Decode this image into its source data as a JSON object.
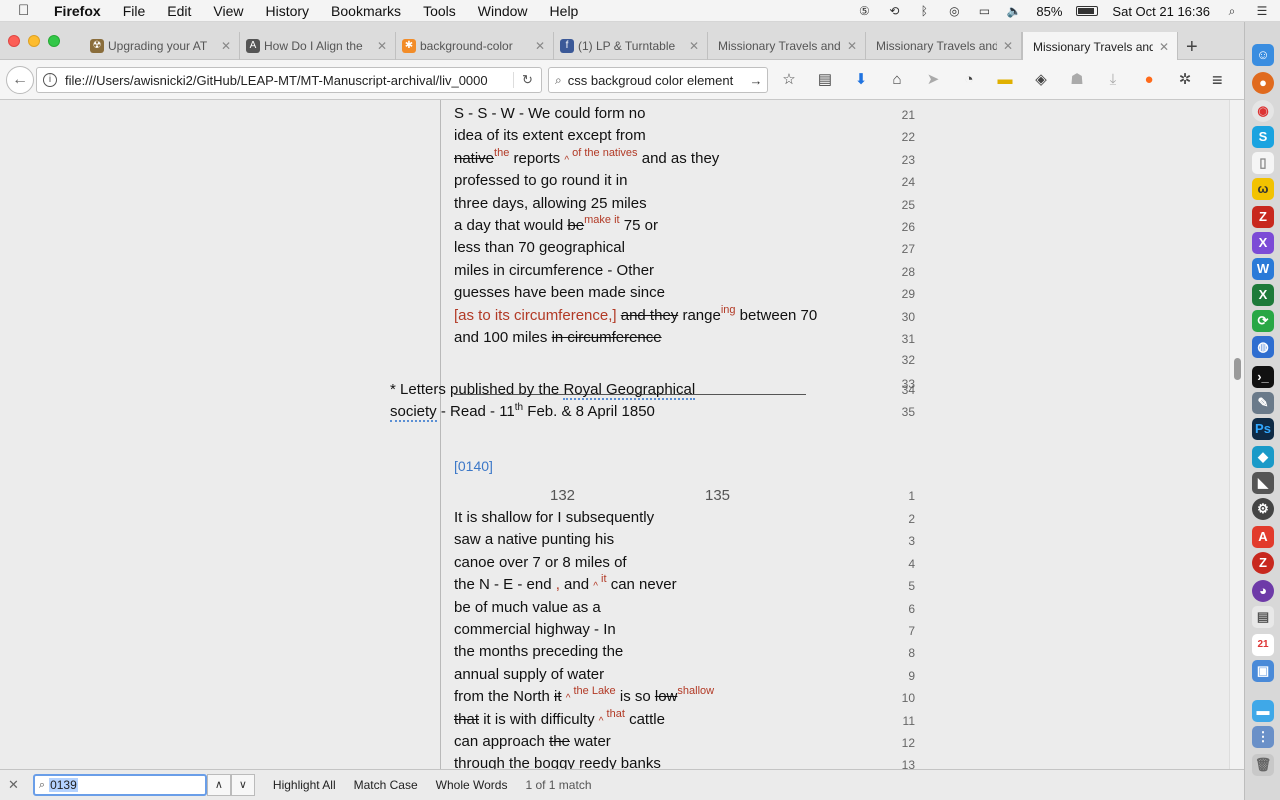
{
  "menubar": {
    "app": "Firefox",
    "items": [
      "File",
      "Edit",
      "View",
      "History",
      "Bookmarks",
      "Tools",
      "Window",
      "Help"
    ],
    "battery": "85%",
    "clock": "Sat Oct 21  16:36"
  },
  "tabs": [
    {
      "title": "Upgrading your AT",
      "icon": "atom-icon",
      "color": "#8a6d3b"
    },
    {
      "title": "How Do I Align the",
      "icon": "bird-icon",
      "color": "#555555"
    },
    {
      "title": "background-color",
      "icon": "star-icon",
      "color": "#f28c28"
    },
    {
      "title": "(1) LP & Turntable",
      "icon": "facebook-icon",
      "color": "#3b5998"
    },
    {
      "title": "Missionary Travels and",
      "icon": "page-icon",
      "color": "#999999"
    },
    {
      "title": "Missionary Travels and",
      "icon": "page-icon",
      "color": "#999999"
    },
    {
      "title": "Missionary Travels and",
      "icon": "page-icon",
      "color": "#999999"
    }
  ],
  "navbar": {
    "url": "file:///Users/awisnicki2/GitHub/LEAP-MT/MT-Manuscript-archival/liv_0000",
    "search": "css backgroud color element"
  },
  "manuscript": {
    "lines_top": [
      {
        "n": "21",
        "parts": [
          {
            "t": "S - S - W - We could form no",
            "c": ""
          }
        ]
      },
      {
        "n": "22",
        "parts": [
          {
            "t": "idea of its extent except from",
            "c": ""
          }
        ]
      },
      {
        "n": "23",
        "parts": [
          {
            "t": "native",
            "c": "del"
          },
          {
            "t": "the",
            "c": "sup"
          },
          {
            "t": " reports ",
            "c": ""
          },
          {
            "t": "^",
            "c": "caret"
          },
          {
            "t": " of the natives",
            "c": "sup"
          },
          {
            "t": " and as they",
            "c": ""
          }
        ]
      },
      {
        "n": "24",
        "parts": [
          {
            "t": "professed to go round it in",
            "c": ""
          }
        ]
      },
      {
        "n": "25",
        "parts": [
          {
            "t": "three days, allowing 25 miles",
            "c": ""
          }
        ]
      },
      {
        "n": "26",
        "parts": [
          {
            "t": "a day that would ",
            "c": ""
          },
          {
            "t": "be",
            "c": "del"
          },
          {
            "t": "make it",
            "c": "sup"
          },
          {
            "t": " 75 or",
            "c": ""
          }
        ]
      },
      {
        "n": "27",
        "parts": [
          {
            "t": "less than 70 geographical",
            "c": ""
          }
        ]
      },
      {
        "n": "28",
        "parts": [
          {
            "t": "miles in circumference - Other",
            "c": ""
          }
        ]
      },
      {
        "n": "29",
        "parts": [
          {
            "t": "guesses have been made since",
            "c": ""
          }
        ]
      },
      {
        "n": "30",
        "parts": [
          {
            "t": "[as to its circumference,]",
            "c": "red"
          },
          {
            "t": " ",
            "c": ""
          },
          {
            "t": "and they",
            "c": "del"
          },
          {
            "t": " range",
            "c": ""
          },
          {
            "t": "ing",
            "c": "sup"
          },
          {
            "t": " between 70",
            "c": ""
          }
        ]
      },
      {
        "n": "31",
        "parts": [
          {
            "t": "and 100 miles ",
            "c": ""
          },
          {
            "t": "in circumference",
            "c": "del"
          }
        ]
      }
    ],
    "line_numbers_footnote": [
      "32",
      "33",
      "34",
      "35"
    ],
    "footnote": {
      "line1_a": "* Letters published by the ",
      "line1_b": "Royal Geographical",
      "line2_a": "society",
      "line2_b": " - Read - 11",
      "line2_sup": "th",
      "line2_c": " Feb. & 8 April 1850"
    },
    "page_link": "[0140]",
    "page_numbers": {
      "left": "132",
      "right": "135",
      "n": "1"
    },
    "lines_bottom": [
      {
        "n": "2",
        "parts": [
          {
            "t": "It is shallow for I subsequently",
            "c": ""
          }
        ]
      },
      {
        "n": "3",
        "parts": [
          {
            "t": "saw a native punting his",
            "c": ""
          }
        ]
      },
      {
        "n": "4",
        "parts": [
          {
            "t": "canoe over 7 or 8 miles of",
            "c": ""
          }
        ]
      },
      {
        "n": "5",
        "parts": [
          {
            "t": "the N - E - end",
            "c": ""
          },
          {
            "t": " ,",
            "c": "red"
          },
          {
            "t": " and ",
            "c": ""
          },
          {
            "t": "^",
            "c": "caret"
          },
          {
            "t": " it",
            "c": "sup"
          },
          {
            "t": " can never",
            "c": ""
          }
        ]
      },
      {
        "n": "6",
        "parts": [
          {
            "t": "be of much value as a",
            "c": ""
          }
        ]
      },
      {
        "n": "7",
        "parts": [
          {
            "t": "commercial highway - In",
            "c": ""
          }
        ]
      },
      {
        "n": "8",
        "parts": [
          {
            "t": "the months preceding the",
            "c": ""
          }
        ]
      },
      {
        "n": "9",
        "parts": [
          {
            "t": "annual supply of water",
            "c": ""
          }
        ]
      },
      {
        "n": "10",
        "parts": [
          {
            "t": "from the North ",
            "c": ""
          },
          {
            "t": "it",
            "c": "del"
          },
          {
            "t": " ",
            "c": ""
          },
          {
            "t": "^",
            "c": "caret"
          },
          {
            "t": " the Lake",
            "c": "sup"
          },
          {
            "t": " is so ",
            "c": ""
          },
          {
            "t": "low",
            "c": "del"
          },
          {
            "t": "shallow",
            "c": "sup"
          }
        ]
      },
      {
        "n": "11",
        "parts": [
          {
            "t": "that",
            "c": "del"
          },
          {
            "t": " it is with difficulty ",
            "c": ""
          },
          {
            "t": "^",
            "c": "caret"
          },
          {
            "t": " that",
            "c": "sup"
          },
          {
            "t": " cattle",
            "c": ""
          }
        ]
      },
      {
        "n": "12",
        "parts": [
          {
            "t": "can approach ",
            "c": ""
          },
          {
            "t": "the",
            "c": "del"
          },
          {
            "t": " water",
            "c": ""
          }
        ]
      },
      {
        "n": "13",
        "parts": [
          {
            "t": "through the boggy reedy banks",
            "c": ""
          }
        ]
      }
    ]
  },
  "findbar": {
    "value": "0139",
    "highlight_all": "Highlight All",
    "match_case": "Match Case",
    "whole_words": "Whole Words",
    "status": "1 of 1 match"
  }
}
